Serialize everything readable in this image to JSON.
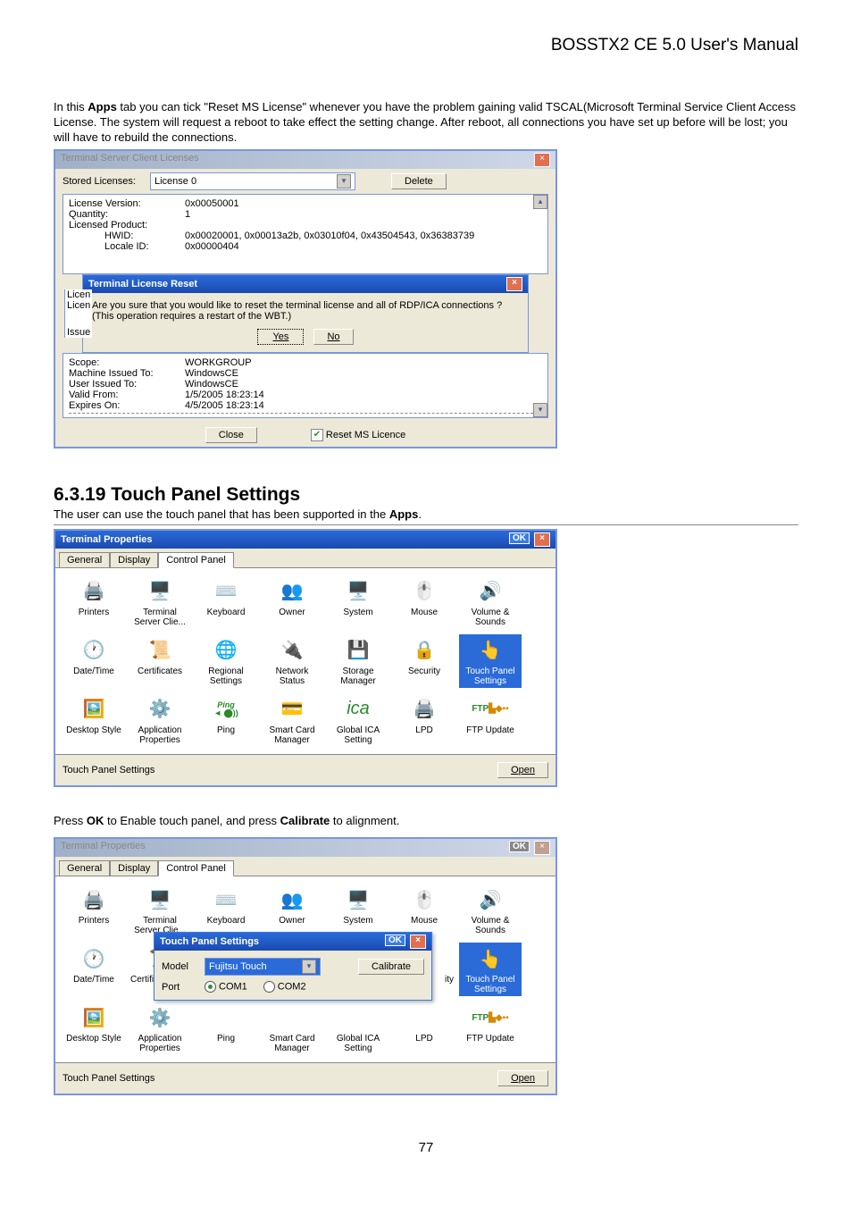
{
  "header": {
    "title": "BOSSTX2 CE 5.0 User's Manual"
  },
  "intro": {
    "p1_prefix": "In this ",
    "p1_bold": "Apps",
    "p1_rest": " tab you can tick \"Reset MS License\" whenever you have the problem gaining valid TSCAL(Microsoft Terminal Service Client Access License. The system will request a reboot to take effect the setting change. After reboot, all connections you have set up before will be lost; you will have to rebuild the connections."
  },
  "dialog1": {
    "title": "Terminal Server Client Licenses",
    "stored_label": "Stored Licenses:",
    "stored_value": "License 0",
    "delete_btn": "Delete",
    "fields": {
      "lv_label": "License Version:",
      "lv_val": "0x00050001",
      "q_label": "Quantity:",
      "q_val": "1",
      "lp_label": "Licensed Product:",
      "hw_label": "HWID:",
      "hw_val": "0x00020001, 0x00013a2b, 0x03010f04, 0x43504543, 0x36383739",
      "loc_label": "Locale ID:",
      "loc_val": "0x00000404"
    },
    "inner": {
      "title": "Terminal License Reset",
      "msg_l1": "Are you sure that you would like to reset the terminal license and all of RDP/ICA connections ?",
      "msg_l2": "(This operation requires a restart of the WBT.)",
      "licen": "Licen",
      "yes": "Yes",
      "no": "No"
    },
    "fields2": {
      "issue": "Issue",
      "scope_l": "Scope:",
      "scope_v": "WORKGROUP",
      "mi_l": "Machine Issued To:",
      "mi_v": "WindowsCE",
      "ui_l": "User Issued To:",
      "ui_v": "WindowsCE",
      "vf_l": "Valid From:",
      "vf_v": "1/5/2005 18:23:14",
      "eo_l": "Expires On:",
      "eo_v": "4/5/2005 18:23:14"
    },
    "close_btn": "Close",
    "reset_chk": "Reset MS Licence"
  },
  "section": {
    "heading": "6.3.19 Touch Panel Settings",
    "sub_pre": "The user can use the touch panel that has been supported in the ",
    "sub_bold": "Apps",
    "sub_post": "."
  },
  "dialog2": {
    "title": "Terminal Properties",
    "tabs": {
      "t1": "General",
      "t2": "Display",
      "t3": "Control Panel"
    },
    "items": [
      "Printers",
      "Terminal Server Clie...",
      "Keyboard",
      "Owner",
      "System",
      "Mouse",
      "Volume & Sounds",
      "Date/Time",
      "Certificates",
      "Regional Settings",
      "Network Status",
      "Storage Manager",
      "Security",
      "Touch Panel Settings",
      "Desktop Style",
      "Application Properties",
      "Ping",
      "Smart Card Manager",
      "Global ICA Setting",
      "LPD",
      "FTP Update"
    ],
    "icons_row3": {
      "ping_top": "Ping",
      "ping_bot": "◄ ⬤))",
      "ftp": "FTP"
    },
    "status": "Touch Panel Settings",
    "open": "Open"
  },
  "mid": {
    "pre": "Press ",
    "ok": "OK",
    "mid": " to Enable touch panel, and press ",
    "cal": "Calibrate",
    "post": " to alignment."
  },
  "dialog3": {
    "title": "Terminal Properties",
    "tabs": {
      "t1": "General",
      "t2": "Display",
      "t3": "Control Panel"
    },
    "items_r1": [
      "Printers",
      "Terminal Server Clie...",
      "Keyboard",
      "Owner",
      "System",
      "Mouse",
      "Volume & Sounds"
    ],
    "items_r2_left": "Date/Time",
    "items_r2_cert": "Certific",
    "items_r2_ity": "ity",
    "items_r2_tp": "Touch Panel Settings",
    "items_r3_ds": "Desktop Style",
    "items_r3_app": "Application Properties",
    "items_r3_ping": "Ping",
    "items_r3_sc_top": "Smart Card",
    "items_r3_sc": "Manager",
    "items_r3_global_top": "Global ICA",
    "items_r3_global": "Setting",
    "items_r3_lpd": "LPD",
    "items_r3_ftp": "FTP Update",
    "ftp_icon": "FTP",
    "modal": {
      "title": "Touch Panel Settings",
      "model_l": "Model",
      "model_v": "Fujitsu Touch",
      "port_l": "Port",
      "com1": "COM1",
      "com2": "COM2",
      "cal": "Calibrate"
    },
    "status": "Touch Panel Settings",
    "open": "Open"
  },
  "page": "77"
}
